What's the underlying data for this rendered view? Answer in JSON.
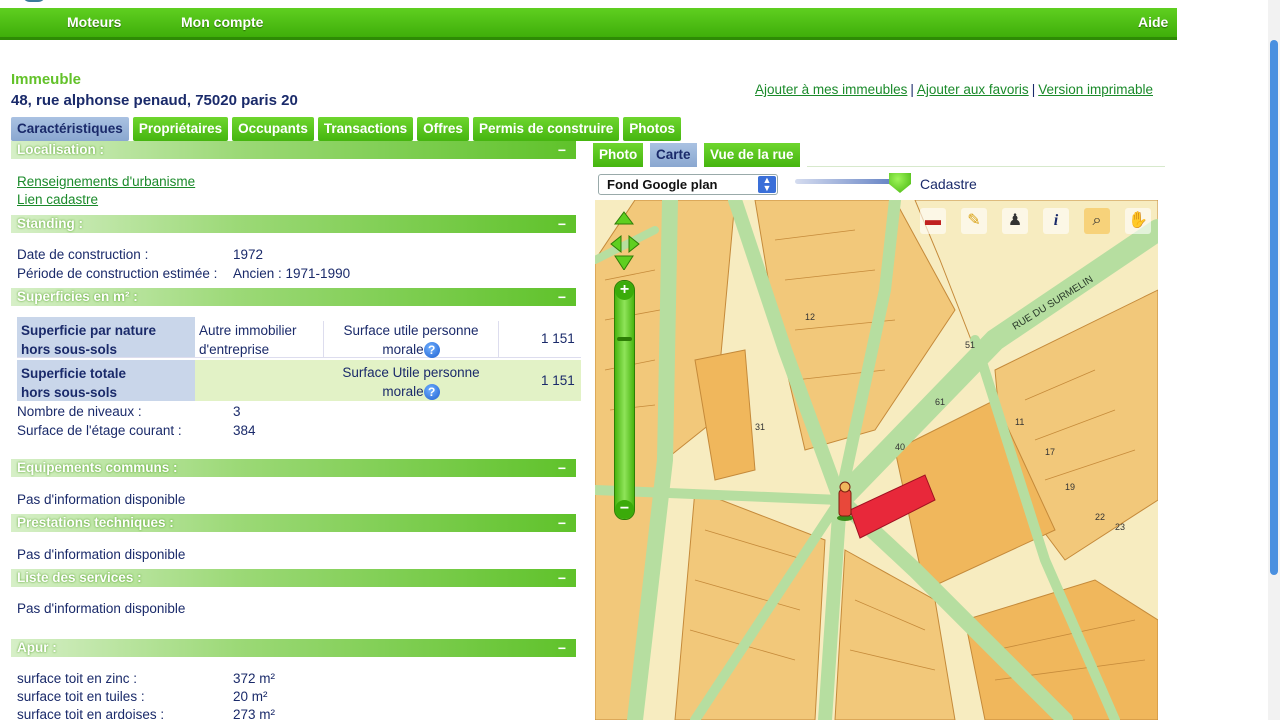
{
  "nav": {
    "moteurs": "Moteurs",
    "compte": "Mon compte",
    "aide": "Aide"
  },
  "header": {
    "kicker": "Immeuble",
    "address": "48, rue alphonse penaud, 75020 paris 20",
    "links": [
      "Ajouter à mes immeubles",
      "Ajouter aux favoris",
      "Version imprimable"
    ],
    "sep": "|"
  },
  "tabs": [
    "Caractéristiques",
    "Propriétaires",
    "Occupants",
    "Transactions",
    "Offres",
    "Permis de construire",
    "Photos"
  ],
  "sections": {
    "localisation": {
      "title": "Localisation :",
      "links": [
        "Renseignements d'urbanisme",
        "Lien cadastre"
      ]
    },
    "standing": {
      "title": "Standing :",
      "rows": [
        {
          "label": "Date de construction :",
          "value": "1972"
        },
        {
          "label": "Période de construction estimée :",
          "value": "Ancien : 1971-1990"
        }
      ]
    },
    "superficies": {
      "title": "Superficies en m² :",
      "row1": {
        "label1": "Superficie par nature",
        "label2": "hors sous-sols",
        "nature1": "Autre immobilier",
        "nature2": "d'entreprise",
        "type1": "Surface utile personne",
        "type2": "morale",
        "value": "1 151"
      },
      "row2": {
        "label1": "Superficie totale",
        "label2": "hors sous-sols",
        "type1": "Surface Utile personne",
        "type2": "morale",
        "value": "1 151"
      },
      "rows": [
        {
          "label": "Nombre de niveaux :",
          "value": "3"
        },
        {
          "label": "Surface de l'étage courant :",
          "value": "384"
        }
      ]
    },
    "equipements": {
      "title": "Equipements communs :",
      "text": "Pas d'information disponible"
    },
    "prestations": {
      "title": "Prestations techniques :",
      "text": "Pas d'information disponible"
    },
    "services": {
      "title": "Liste des services :",
      "text": "Pas d'information disponible"
    },
    "apur": {
      "title": "Apur :",
      "rows": [
        {
          "label": "surface toit en zinc :",
          "value": "372 m²"
        },
        {
          "label": "surface toit en tuiles :",
          "value": "20 m²"
        },
        {
          "label": "surface toit en ardoises :",
          "value": "273 m²"
        }
      ]
    },
    "collapse": "−"
  },
  "help_glyph": "?",
  "map": {
    "tabs": [
      "Photo",
      "Carte",
      "Vue de la rue"
    ],
    "active_tab": "Carte",
    "layer_select": "Fond Google plan",
    "slider_label": "Cadastre",
    "street_label": "RUE DU SURMELIN",
    "zoom_in": "+",
    "zoom_out": "−",
    "tools": [
      "ruler-icon",
      "highlighter-icon",
      "pegman-icon",
      "info-icon",
      "zoom-icon",
      "hand-icon"
    ],
    "tool_glyphs": [
      "▬",
      "✎",
      "♟",
      "i",
      "⌕",
      "✋"
    ],
    "numbers": [
      "51",
      "61",
      "11",
      "17",
      "19",
      "40",
      "22",
      "23",
      "31",
      "12"
    ],
    "colors": {
      "road": "#b6dea0",
      "block": "#f2c87a",
      "building": "#f0b75c",
      "highlight": "#e8283a"
    }
  }
}
